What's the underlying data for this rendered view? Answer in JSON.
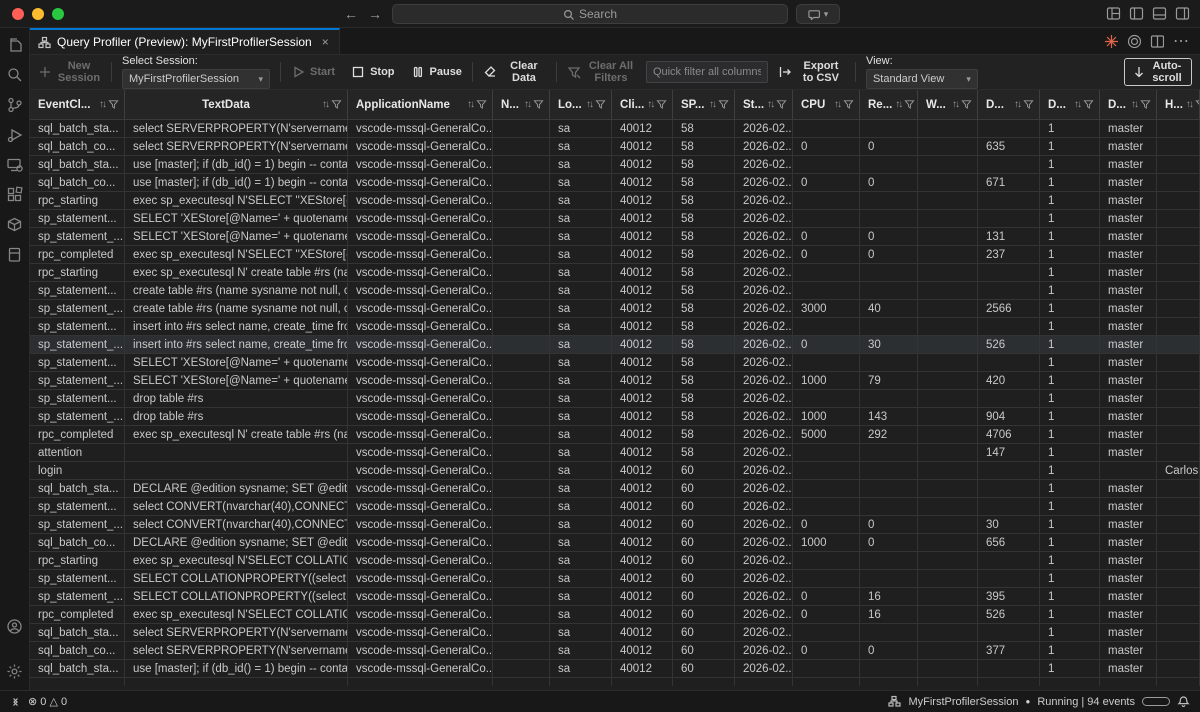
{
  "titlebar": {
    "search_placeholder": "Search"
  },
  "tab": {
    "title": "Query Profiler (Preview): MyFirstProfilerSession",
    "close_glyph": "×"
  },
  "toolbar": {
    "new_session": "New Session",
    "select_session_label": "Select Session:",
    "session_value": "MyFirstProfilerSession",
    "start": "Start",
    "stop": "Stop",
    "pause": "Pause",
    "clear_data": "Clear Data",
    "clear_all_filters": "Clear All Filters",
    "quick_filter_placeholder": "Quick filter all columns...",
    "export_csv": "Export to CSV",
    "view_label": "View:",
    "view_value": "Standard View",
    "autoscroll": "Auto-scroll"
  },
  "table": {
    "columns": [
      {
        "label": "EventCl...",
        "key": "event_class"
      },
      {
        "label": "TextData",
        "key": "text_data"
      },
      {
        "label": "ApplicationName",
        "key": "application_name"
      },
      {
        "label": "N...",
        "key": "nt_user_name"
      },
      {
        "label": "Lo...",
        "key": "login_name"
      },
      {
        "label": "Cli...",
        "key": "client_process_id"
      },
      {
        "label": "SP...",
        "key": "spid"
      },
      {
        "label": "St...",
        "key": "start_time"
      },
      {
        "label": "CPU",
        "key": "cpu"
      },
      {
        "label": "Re...",
        "key": "reads"
      },
      {
        "label": "W...",
        "key": "writes"
      },
      {
        "label": "D...",
        "key": "duration"
      },
      {
        "label": "D...",
        "key": "database_id"
      },
      {
        "label": "D...",
        "key": "database_name"
      },
      {
        "label": "H...",
        "key": "host_name"
      }
    ],
    "selected_row_index": 12,
    "rows": [
      [
        "sql_batch_sta...",
        "select SERVERPROPERTY(N'servername')",
        "vscode-mssql-GeneralCo...",
        "",
        "sa",
        "40012",
        "58",
        "2026-02...",
        "",
        "",
        "",
        "",
        "1",
        "master",
        ""
      ],
      [
        "sql_batch_co...",
        "select SERVERPROPERTY(N'servername')",
        "vscode-mssql-GeneralCo...",
        "",
        "sa",
        "40012",
        "58",
        "2026-02...",
        "0",
        "0",
        "",
        "635",
        "1",
        "master",
        ""
      ],
      [
        "sql_batch_sta...",
        "use [master]; if (db_id() = 1) begin -- contai...",
        "vscode-mssql-GeneralCo...",
        "",
        "sa",
        "40012",
        "58",
        "2026-02...",
        "",
        "",
        "",
        "",
        "1",
        "master",
        ""
      ],
      [
        "sql_batch_co...",
        "use [master]; if (db_id() = 1) begin -- contai...",
        "vscode-mssql-GeneralCo...",
        "",
        "sa",
        "40012",
        "58",
        "2026-02...",
        "0",
        "0",
        "",
        "671",
        "1",
        "master",
        ""
      ],
      [
        "rpc_starting",
        "exec sp_executesql N'SELECT ''XEStore[@...",
        "vscode-mssql-GeneralCo...",
        "",
        "sa",
        "40012",
        "58",
        "2026-02...",
        "",
        "",
        "",
        "",
        "1",
        "master",
        ""
      ],
      [
        "sp_statement...",
        "SELECT 'XEStore[@Name=' + quotename(C...",
        "vscode-mssql-GeneralCo...",
        "",
        "sa",
        "40012",
        "58",
        "2026-02...",
        "",
        "",
        "",
        "",
        "1",
        "master",
        ""
      ],
      [
        "sp_statement_...",
        "SELECT 'XEStore[@Name=' + quotename(C...",
        "vscode-mssql-GeneralCo...",
        "",
        "sa",
        "40012",
        "58",
        "2026-02...",
        "0",
        "0",
        "",
        "131",
        "1",
        "master",
        ""
      ],
      [
        "rpc_completed",
        "exec sp_executesql N'SELECT ''XEStore[@...",
        "vscode-mssql-GeneralCo...",
        "",
        "sa",
        "40012",
        "58",
        "2026-02...",
        "0",
        "0",
        "",
        "237",
        "1",
        "master",
        ""
      ],
      [
        "rpc_starting",
        "exec sp_executesql N' create table #rs (nam...",
        "vscode-mssql-GeneralCo...",
        "",
        "sa",
        "40012",
        "58",
        "2026-02...",
        "",
        "",
        "",
        "",
        "1",
        "master",
        ""
      ],
      [
        "sp_statement...",
        "create table #rs (name sysname not null, cre...",
        "vscode-mssql-GeneralCo...",
        "",
        "sa",
        "40012",
        "58",
        "2026-02...",
        "",
        "",
        "",
        "",
        "1",
        "master",
        ""
      ],
      [
        "sp_statement_...",
        "create table #rs (name sysname not null, cre...",
        "vscode-mssql-GeneralCo...",
        "",
        "sa",
        "40012",
        "58",
        "2026-02...",
        "3000",
        "40",
        "",
        "2566",
        "1",
        "master",
        ""
      ],
      [
        "sp_statement...",
        "insert into #rs select name, create_time fro...",
        "vscode-mssql-GeneralCo...",
        "",
        "sa",
        "40012",
        "58",
        "2026-02...",
        "",
        "",
        "",
        "",
        "1",
        "master",
        ""
      ],
      [
        "sp_statement_...",
        "insert into #rs select name, create_time fro...",
        "vscode-mssql-GeneralCo...",
        "",
        "sa",
        "40012",
        "58",
        "2026-02...",
        "0",
        "30",
        "",
        "526",
        "1",
        "master",
        ""
      ],
      [
        "sp_statement...",
        "SELECT 'XEStore[@Name=' + quotename(C...",
        "vscode-mssql-GeneralCo...",
        "",
        "sa",
        "40012",
        "58",
        "2026-02...",
        "",
        "",
        "",
        "",
        "1",
        "master",
        ""
      ],
      [
        "sp_statement_...",
        "SELECT 'XEStore[@Name=' + quotename(C...",
        "vscode-mssql-GeneralCo...",
        "",
        "sa",
        "40012",
        "58",
        "2026-02...",
        "1000",
        "79",
        "",
        "420",
        "1",
        "master",
        ""
      ],
      [
        "sp_statement...",
        "drop table #rs",
        "vscode-mssql-GeneralCo...",
        "",
        "sa",
        "40012",
        "58",
        "2026-02...",
        "",
        "",
        "",
        "",
        "1",
        "master",
        ""
      ],
      [
        "sp_statement_...",
        "drop table #rs",
        "vscode-mssql-GeneralCo...",
        "",
        "sa",
        "40012",
        "58",
        "2026-02...",
        "1000",
        "143",
        "",
        "904",
        "1",
        "master",
        ""
      ],
      [
        "rpc_completed",
        "exec sp_executesql N' create table #rs (nam...",
        "vscode-mssql-GeneralCo...",
        "",
        "sa",
        "40012",
        "58",
        "2026-02...",
        "5000",
        "292",
        "",
        "4706",
        "1",
        "master",
        ""
      ],
      [
        "attention",
        "",
        "vscode-mssql-GeneralCo...",
        "",
        "sa",
        "40012",
        "58",
        "2026-02...",
        "",
        "",
        "",
        "147",
        "1",
        "master",
        ""
      ],
      [
        "login",
        "",
        "vscode-mssql-GeneralCo...",
        "",
        "sa",
        "40012",
        "60",
        "2026-02...",
        "",
        "",
        "",
        "",
        "1",
        "",
        "Carlos..."
      ],
      [
        "sql_batch_sta...",
        "DECLARE @edition sysname; SET @edition ...",
        "vscode-mssql-GeneralCo...",
        "",
        "sa",
        "40012",
        "60",
        "2026-02...",
        "",
        "",
        "",
        "",
        "1",
        "master",
        ""
      ],
      [
        "sp_statement...",
        "select CONVERT(nvarchar(40),CONNECTIO...",
        "vscode-mssql-GeneralCo...",
        "",
        "sa",
        "40012",
        "60",
        "2026-02...",
        "",
        "",
        "",
        "",
        "1",
        "master",
        ""
      ],
      [
        "sp_statement_...",
        "select CONVERT(nvarchar(40),CONNECTIO...",
        "vscode-mssql-GeneralCo...",
        "",
        "sa",
        "40012",
        "60",
        "2026-02...",
        "0",
        "0",
        "",
        "30",
        "1",
        "master",
        ""
      ],
      [
        "sql_batch_co...",
        "DECLARE @edition sysname; SET @edition ...",
        "vscode-mssql-GeneralCo...",
        "",
        "sa",
        "40012",
        "60",
        "2026-02...",
        "1000",
        "0",
        "",
        "656",
        "1",
        "master",
        ""
      ],
      [
        "rpc_starting",
        "exec sp_executesql N'SELECT COLLATIONP...",
        "vscode-mssql-GeneralCo...",
        "",
        "sa",
        "40012",
        "60",
        "2026-02...",
        "",
        "",
        "",
        "",
        "1",
        "master",
        ""
      ],
      [
        "sp_statement...",
        "SELECT COLLATIONPROPERTY((select coll...",
        "vscode-mssql-GeneralCo...",
        "",
        "sa",
        "40012",
        "60",
        "2026-02...",
        "",
        "",
        "",
        "",
        "1",
        "master",
        ""
      ],
      [
        "sp_statement_...",
        "SELECT COLLATIONPROPERTY((select coll...",
        "vscode-mssql-GeneralCo...",
        "",
        "sa",
        "40012",
        "60",
        "2026-02...",
        "0",
        "16",
        "",
        "395",
        "1",
        "master",
        ""
      ],
      [
        "rpc_completed",
        "exec sp_executesql N'SELECT COLLATIONP...",
        "vscode-mssql-GeneralCo...",
        "",
        "sa",
        "40012",
        "60",
        "2026-02...",
        "0",
        "16",
        "",
        "526",
        "1",
        "master",
        ""
      ],
      [
        "sql_batch_sta...",
        "select SERVERPROPERTY(N'servername')",
        "vscode-mssql-GeneralCo...",
        "",
        "sa",
        "40012",
        "60",
        "2026-02...",
        "",
        "",
        "",
        "",
        "1",
        "master",
        ""
      ],
      [
        "sql_batch_co...",
        "select SERVERPROPERTY(N'servername')",
        "vscode-mssql-GeneralCo...",
        "",
        "sa",
        "40012",
        "60",
        "2026-02...",
        "0",
        "0",
        "",
        "377",
        "1",
        "master",
        ""
      ],
      [
        "sql_batch_sta...",
        "use [master]; if (db_id() = 1) begin -- contai...",
        "vscode-mssql-GeneralCo...",
        "",
        "sa",
        "40012",
        "60",
        "2026-02...",
        "",
        "",
        "",
        "",
        "1",
        "master",
        ""
      ]
    ]
  },
  "statusbar": {
    "errors": "0",
    "warnings": "0",
    "session_name": "MyFirstProfilerSession",
    "session_state": "Running | 94 events"
  },
  "colors": {
    "accent_blue": "#0078d4",
    "starburst_orange": "#e0654a",
    "traffic_red": "#ff5f57",
    "traffic_yellow": "#febc2e",
    "traffic_green": "#28c840"
  }
}
